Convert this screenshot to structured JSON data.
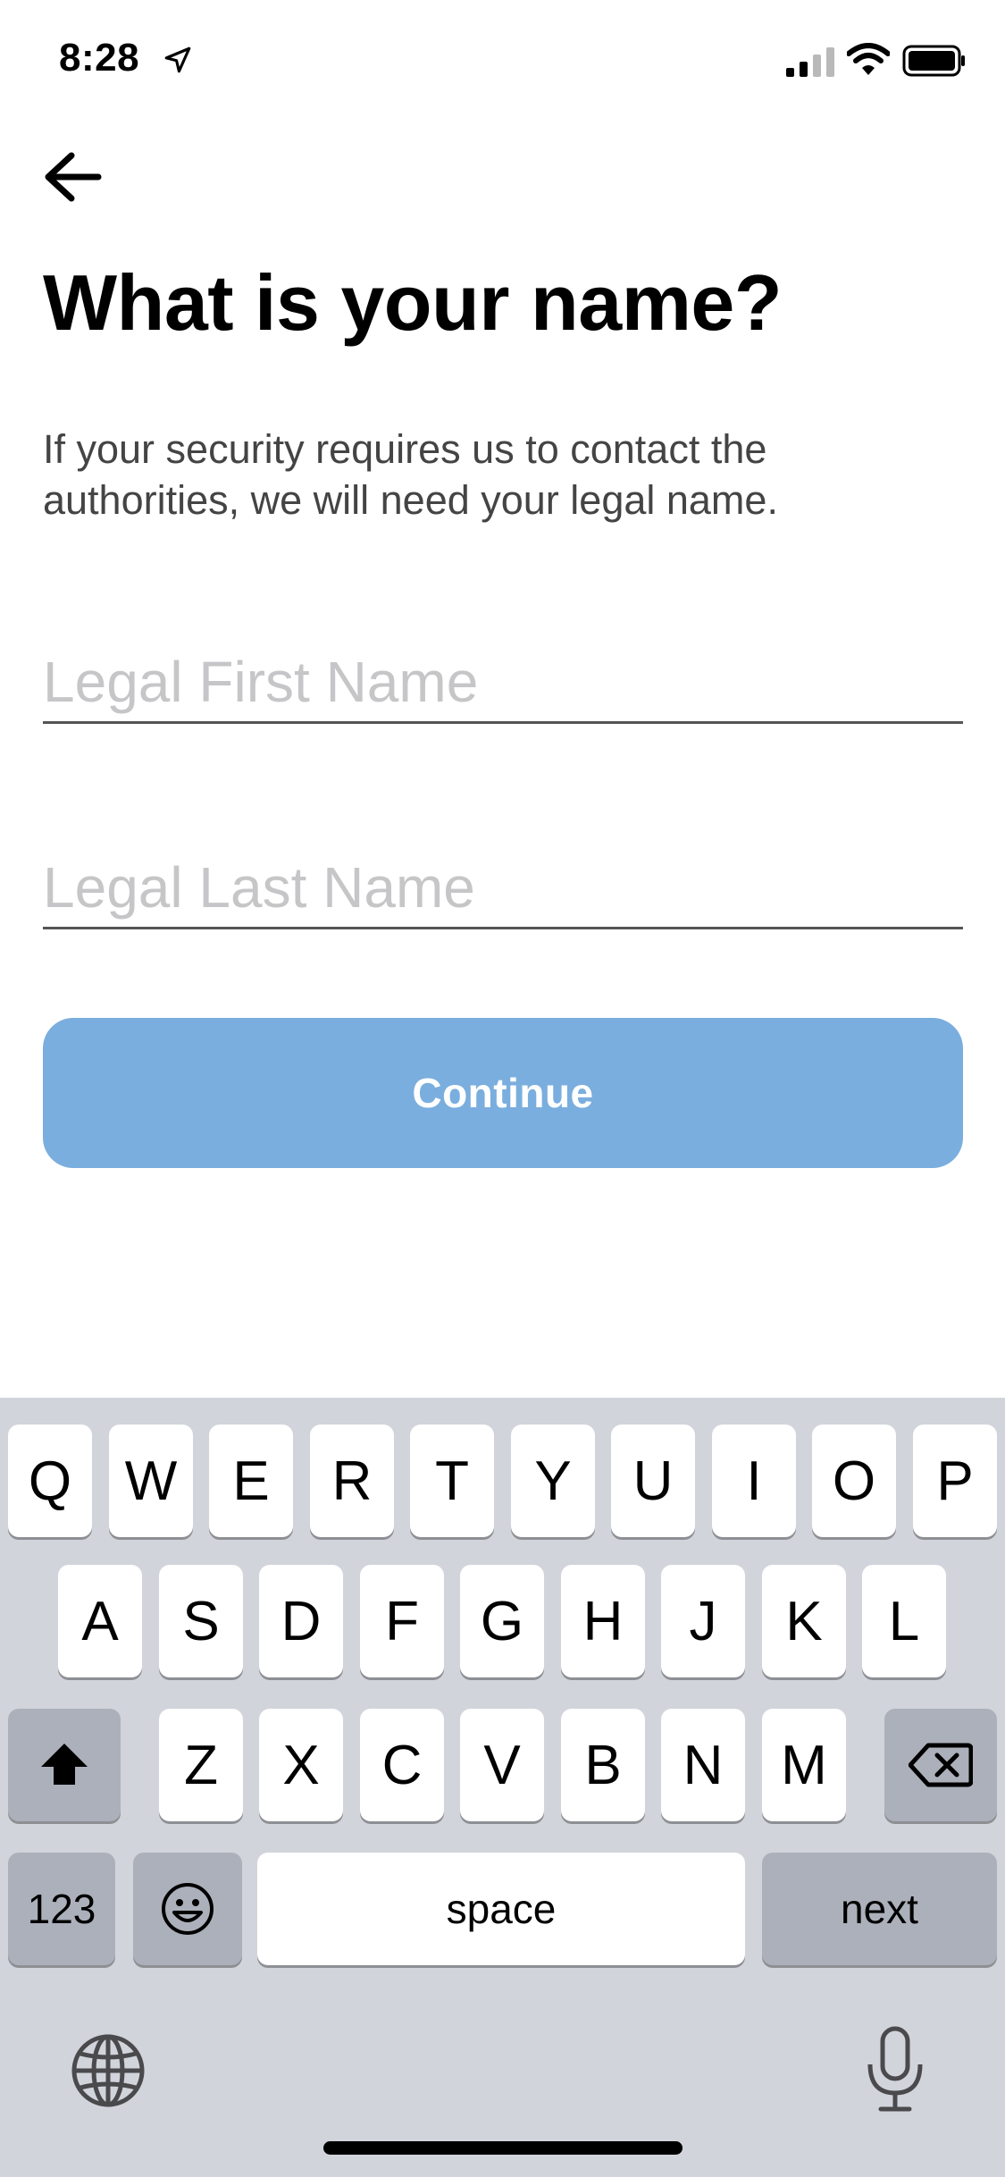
{
  "status_bar": {
    "time": "8:28",
    "icons": [
      "location-arrow-icon",
      "cellular-signal-icon",
      "wifi-icon",
      "battery-icon"
    ]
  },
  "navigation": {
    "back_icon": "arrow-left-icon"
  },
  "main": {
    "title": "What is your name?",
    "subtitle": "If your security requires us to contact the authorities, we will need your legal name.",
    "first_name": {
      "value": "",
      "placeholder": "Legal First Name"
    },
    "last_name": {
      "value": "",
      "placeholder": "Legal Last Name"
    },
    "continue_label": "Continue",
    "continue_color": "#7aaede"
  },
  "keyboard": {
    "row1": [
      "Q",
      "W",
      "E",
      "R",
      "T",
      "Y",
      "U",
      "I",
      "O",
      "P"
    ],
    "row2": [
      "A",
      "S",
      "D",
      "F",
      "G",
      "H",
      "J",
      "K",
      "L"
    ],
    "row3": [
      "Z",
      "X",
      "C",
      "V",
      "B",
      "N",
      "M"
    ],
    "numbers_label": "123",
    "space_label": "space",
    "next_label": "next",
    "icons": [
      "shift-icon",
      "backspace-icon",
      "emoji-icon",
      "globe-icon",
      "microphone-icon"
    ]
  }
}
